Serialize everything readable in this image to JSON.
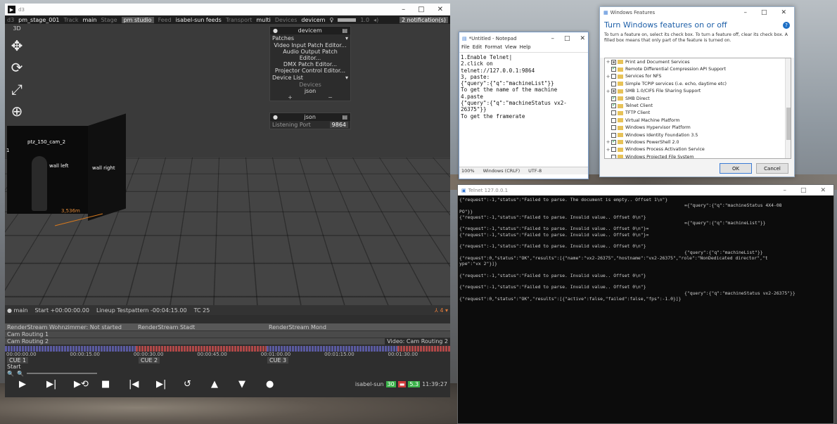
{
  "d3": {
    "title_small": "d3",
    "menubar": [
      {
        "k": "d3",
        "v": "pm_stage_001"
      },
      {
        "k": "Track",
        "v": "main"
      },
      {
        "k": "Stage",
        "v": "pm studio"
      },
      {
        "k": "Feed",
        "v": "isabel-sun feeds"
      },
      {
        "k": "Transport",
        "v": "multi"
      },
      {
        "k": "Devices",
        "v": "devicem"
      }
    ],
    "volume_value": "1.0",
    "notification": "2 notification(s)",
    "view_label": "3D",
    "scene_labels": {
      "cam": "ptz_150_cam_2",
      "wall_left": "wall left",
      "wall_right": "wall right",
      "edge": "1",
      "distance": "3,536m"
    },
    "device_panel": {
      "title": "devicem",
      "patches_label": "Patches",
      "patches": [
        "Video Input Patch Editor...",
        "Audio Output Patch Editor...",
        "DMX Patch Editor...",
        "Projector Control Editor..."
      ],
      "device_list_label": "Device List",
      "devices_header": "Devices",
      "devices": [
        "json"
      ],
      "add": "+",
      "remove": "−"
    },
    "json_panel": {
      "title": "json",
      "port_label": "Listening Port",
      "port_value": "9864"
    },
    "timeline": {
      "track": "main",
      "start": "Start +00:00:00.00",
      "lineup": "Lineup Testpattern -00:04:15.00",
      "tc": "TC 25",
      "counts": "4",
      "renderstreams": [
        "RenderStream Wohnzimmer: Not started",
        "RenderStream Stadt",
        "RenderStream Mond"
      ],
      "cam_routing_1": "Cam Routing 1",
      "cam_routing_2": "Cam Routing 2",
      "video_label": "Video: Cam Routing 2",
      "timecodes": [
        "00:00:00.00",
        "00:00:15.00",
        "00:00:30.00",
        "00:00:45.00",
        "00:01:00.00",
        "00:01:15.00",
        "00:01:30.00"
      ],
      "cues": [
        "CUE 1",
        "CUE 2",
        "CUE 3"
      ],
      "start_label": "Start",
      "user": "isabel-sun",
      "fps": "30",
      "bitrate": "5.3",
      "clock": "11:39:27"
    },
    "transport_buttons": [
      "play",
      "play-to-end",
      "loop-section",
      "stop",
      "prev-section",
      "next-section",
      "return",
      "up",
      "down",
      "record"
    ]
  },
  "notepad": {
    "title": "*Untitled - Notepad",
    "menu": [
      "File",
      "Edit",
      "Format",
      "View",
      "Help"
    ],
    "text": "1.Enable Telnet|\n2.click on\ntelnet://127.0.0.1:9864\n3, paste:\n{\"query\":{\"q\":\"machineList\"}}\nTo get the name of the machine\n4.paste\n{\"query\":{\"q\":\"machineStatus vx2-\n26375\"}}\nTo get the framerate",
    "status": {
      "zoom": "100%",
      "eol": "Windows (CRLF)",
      "encoding": "UTF-8"
    }
  },
  "windows_features": {
    "title": "Windows Features",
    "heading": "Turn Windows features on or off",
    "description": "To turn a feature on, select its check box. To turn a feature off, clear its check box. A filled box means that only part of the feature is turned on.",
    "items": [
      {
        "label": "Print and Document Services",
        "state": "part",
        "expand": "+"
      },
      {
        "label": "Remote Differential Compression API Support",
        "state": "on",
        "expand": ""
      },
      {
        "label": "Services for NFS",
        "state": "off",
        "expand": "+"
      },
      {
        "label": "Simple TCPIP services (i.e. echo, daytime etc)",
        "state": "off",
        "expand": ""
      },
      {
        "label": "SMB 1.0/CIFS File Sharing Support",
        "state": "part",
        "expand": "+"
      },
      {
        "label": "SMB Direct",
        "state": "on",
        "expand": ""
      },
      {
        "label": "Telnet Client",
        "state": "on",
        "expand": ""
      },
      {
        "label": "TFTP Client",
        "state": "off",
        "expand": ""
      },
      {
        "label": "Virtual Machine Platform",
        "state": "off",
        "expand": ""
      },
      {
        "label": "Windows Hypervisor Platform",
        "state": "off",
        "expand": ""
      },
      {
        "label": "Windows Identity Foundation 3.5",
        "state": "off",
        "expand": ""
      },
      {
        "label": "Windows PowerShell 2.0",
        "state": "on",
        "expand": "+"
      },
      {
        "label": "Windows Process Activation Service",
        "state": "off",
        "expand": "+"
      },
      {
        "label": "Windows Projected File System",
        "state": "off",
        "expand": ""
      }
    ],
    "ok": "OK",
    "cancel": "Cancel"
  },
  "telnet": {
    "title": "Telnet 127.0.0.1",
    "lines": [
      {
        "t": "{\"request\":-1,\"status\":\"Failed to parse. The document is empty.. Offset 1\\n\"}",
        "r": false
      },
      {
        "t": "={\"query\":{\"q\":\"machineStatus 4X4-08",
        "r": true
      },
      {
        "t": "PO\"}}",
        "r": false
      },
      {
        "t": "{\"request\":-1,\"status\":\"Failed to parse. Invalid value.. Offset 0\\n\"}",
        "r": false
      },
      {
        "t": "={\"query\":{\"q\":\"machineList\"}}",
        "r": true
      },
      {
        "t": "{\"request\":-1,\"status\":\"Failed to parse. Invalid value.. Offset 0\\n\"}=",
        "r": false
      },
      {
        "t": "{\"request\":-1,\"status\":\"Failed to parse. Invalid value.. Offset 0\\n\"}=",
        "r": false
      },
      {
        "t": "",
        "r": false
      },
      {
        "t": "{\"request\":-1,\"status\":\"Failed to parse. Invalid value.. Offset 0\\n\"}",
        "r": false
      },
      {
        "t": "{\"query\":{\"q\":\"machineList\"}}",
        "r": true
      },
      {
        "t": "{\"request\":0,\"status\":\"OK\",\"results\":[{\"name\":\"vx2-26375\",\"hostname\":\"vx2-26375\",\"role\":\"NonDedicated director\",\"t",
        "r": false
      },
      {
        "t": "ype\":\"vx 2\"}]}",
        "r": false
      },
      {
        "t": "",
        "r": false
      },
      {
        "t": "{\"request\":-1,\"status\":\"Failed to parse. Invalid value.. Offset 0\\n\"}",
        "r": false
      },
      {
        "t": "",
        "r": false
      },
      {
        "t": "{\"request\":-1,\"status\":\"Failed to parse. Invalid value.. Offset 0\\n\"}",
        "r": false
      },
      {
        "t": "{\"query\":{\"q\":\"machineStatus vx2-26375\"}}",
        "r": true
      },
      {
        "t": "{\"request\":0,\"status\":\"OK\",\"results\":[{\"active\":false,\"failed\":false,\"fps\":-1.0}]}",
        "r": false
      }
    ]
  },
  "colors": {
    "cue_blue": "#5a5aa0",
    "cue_red": "#b04848",
    "accent": "#1d5fa8"
  }
}
